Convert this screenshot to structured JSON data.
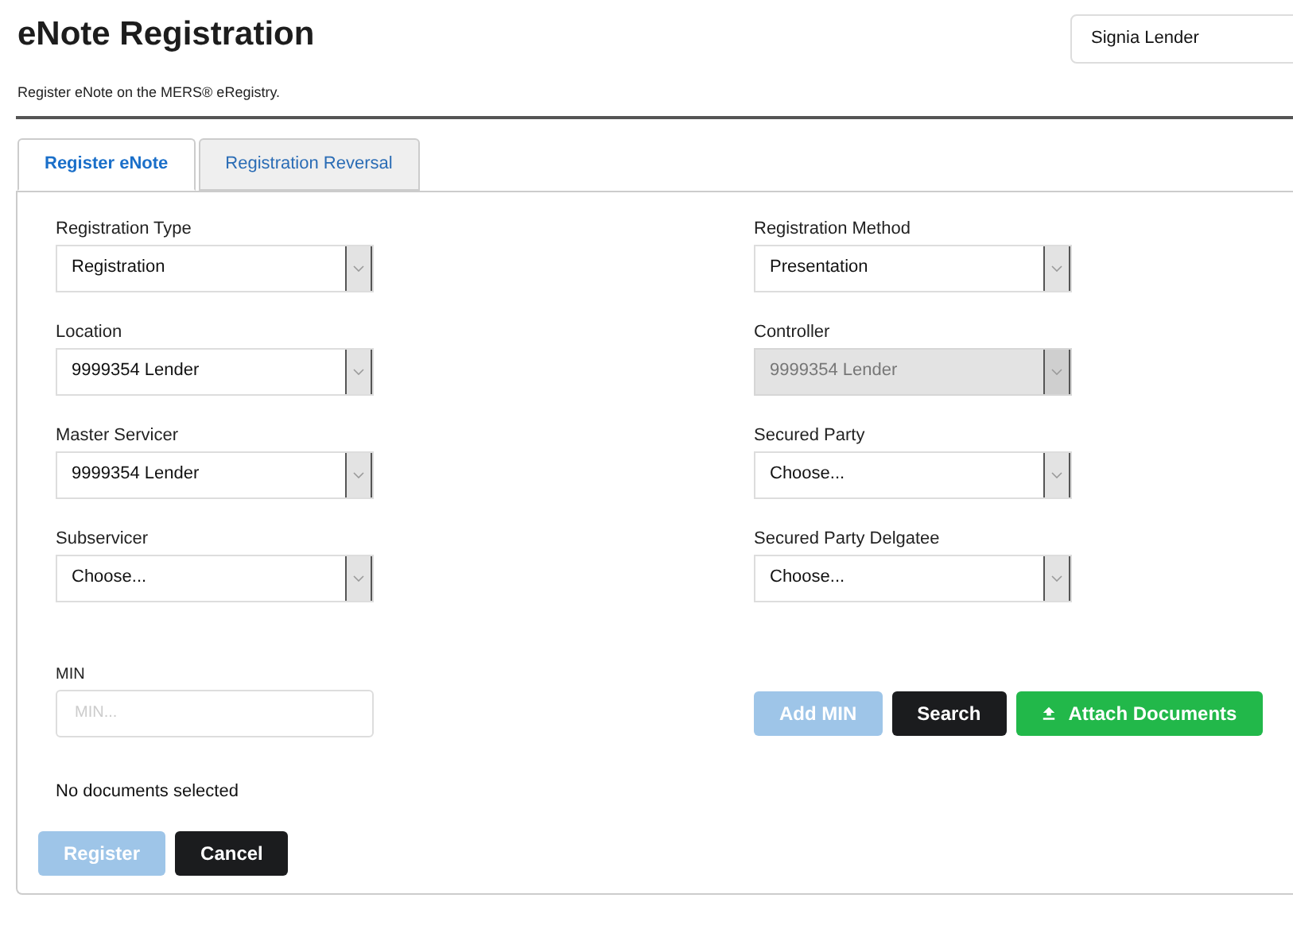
{
  "header": {
    "title": "eNote Registration",
    "subtitle": "Register eNote on the MERS® eRegistry."
  },
  "user_select": {
    "value": "Signia Lender"
  },
  "tabs": [
    {
      "label": "Register eNote",
      "selected": true
    },
    {
      "label": "Registration Reversal",
      "selected": false
    }
  ],
  "form": {
    "left_fields": [
      {
        "label": "Registration Type",
        "value": "Registration",
        "disabled": false
      },
      {
        "label": "Location",
        "value": "9999354 Lender",
        "disabled": false
      },
      {
        "label": "Master Servicer",
        "value": "9999354 Lender",
        "disabled": false
      },
      {
        "label": "Subservicer",
        "value": "Choose...",
        "disabled": false
      }
    ],
    "right_fields": [
      {
        "label": "Registration Method",
        "value": "Presentation",
        "disabled": false
      },
      {
        "label": "Controller",
        "value": "9999354 Lender",
        "disabled": true
      },
      {
        "label": "Secured Party",
        "value": "Choose...",
        "disabled": false
      },
      {
        "label": "Secured Party Delgatee",
        "value": "Choose...",
        "disabled": false
      }
    ],
    "min_field": {
      "label": "MIN",
      "placeholder": "MIN..."
    },
    "actions": [
      {
        "label": "Add MIN",
        "kind": "primary",
        "disabled": true
      },
      {
        "label": "Search",
        "kind": "dark",
        "disabled": false
      },
      {
        "label": "Attach Documents",
        "kind": "success",
        "disabled": false
      }
    ],
    "status": "No documents selected",
    "footer_buttons": [
      {
        "label": "Register",
        "kind": "primary",
        "disabled": true
      },
      {
        "label": "Cancel",
        "kind": "dark",
        "disabled": false
      }
    ]
  }
}
